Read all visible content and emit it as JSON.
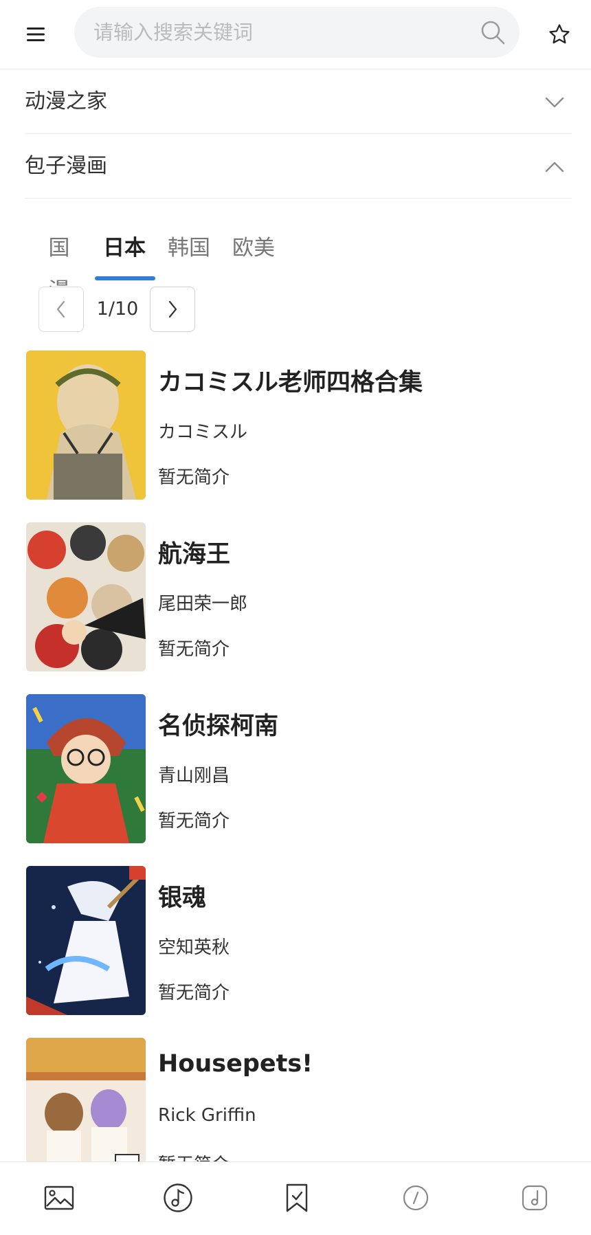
{
  "search": {
    "placeholder": "请输入搜索关键词"
  },
  "sources": [
    {
      "name": "动漫之家",
      "expanded": false
    },
    {
      "name": "包子漫画",
      "expanded": true
    }
  ],
  "tabs": [
    {
      "label": "国漫"
    },
    {
      "label": "日本",
      "active": true
    },
    {
      "label": "韩国"
    },
    {
      "label": "欧美"
    }
  ],
  "pager": {
    "text": "1/10"
  },
  "comics": [
    {
      "title": "カコミスル老师四格合集",
      "author": "カコミスル",
      "intro": "暂无简介"
    },
    {
      "title": "航海王",
      "author": "尾田荣一郎",
      "intro": "暂无简介"
    },
    {
      "title": "名侦探柯南",
      "author": "青山刚昌",
      "intro": "暂无简介"
    },
    {
      "title": "银魂",
      "author": "空知英秋",
      "intro": "暂无简介"
    },
    {
      "title": "Housepets!",
      "author": "Rick Griffin",
      "intro": "暂无简介"
    }
  ],
  "bottom_nav": [
    {
      "icon": "image-icon"
    },
    {
      "icon": "music-note-icon"
    },
    {
      "icon": "bookmark-icon"
    },
    {
      "icon": "compass-icon"
    },
    {
      "icon": "music-box-icon"
    }
  ],
  "colors": {
    "accent": "#2f7fd6",
    "search_bg": "#f2f4f5"
  }
}
